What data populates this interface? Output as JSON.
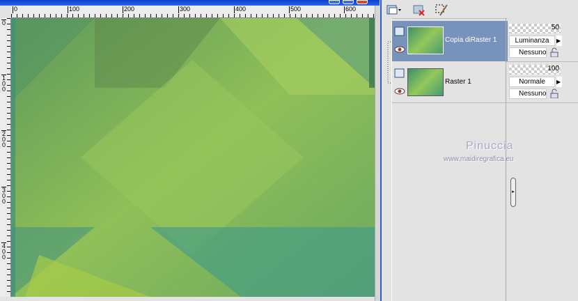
{
  "ruler": {
    "h": [
      "0",
      "100",
      "200",
      "300",
      "400",
      "500",
      "600"
    ],
    "v": [
      "0",
      "1\n0\n0",
      "2\n0\n0",
      "3\n0\n0",
      "4\n0\n0"
    ]
  },
  "layers": [
    {
      "name": "Copia diRaster 1",
      "opacity": "50",
      "blend": "Luminanza",
      "mask": "Nessuno",
      "selected": true
    },
    {
      "name": "Raster 1",
      "opacity": "100",
      "blend": "Normale",
      "mask": "Nessuno",
      "selected": false
    }
  ],
  "watermark": {
    "name": "Pinuccia",
    "site": "www.maidiregrafica.eu"
  },
  "colors": {
    "selected_row": "#7793bb",
    "titlebar": "#1a50dc"
  }
}
